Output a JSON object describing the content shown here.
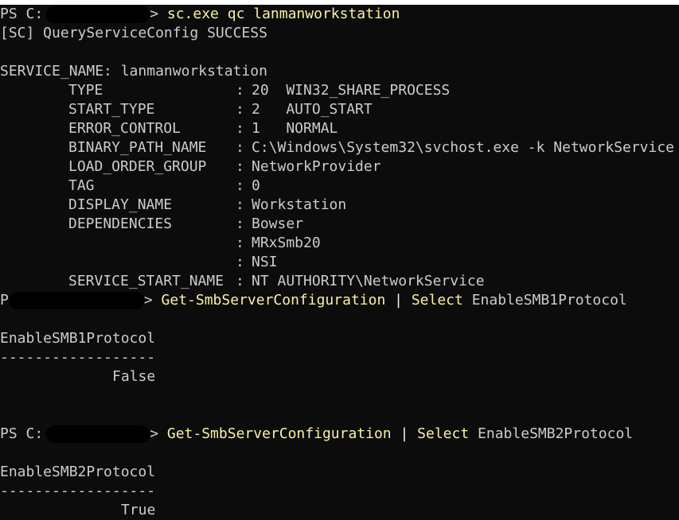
{
  "colors": {
    "background": "#0c0c0c",
    "foreground": "#cccccc",
    "command": "#f9f1a5",
    "operator": "#f2f2f2"
  },
  "prompt1": {
    "prefix": "PS C:",
    "suffix": ">",
    "command": "sc.exe qc lanmanworkstation"
  },
  "sc_output": {
    "result": "[SC] QueryServiceConfig SUCCESS",
    "service_name": "SERVICE_NAME: lanmanworkstation",
    "fields": [
      {
        "key": "TYPE",
        "value": "20  WIN32_SHARE_PROCESS"
      },
      {
        "key": "START_TYPE",
        "value": "2   AUTO_START"
      },
      {
        "key": "ERROR_CONTROL",
        "value": "1   NORMAL"
      },
      {
        "key": "BINARY_PATH_NAME",
        "value": "C:\\Windows\\System32\\svchost.exe -k NetworkService"
      },
      {
        "key": "LOAD_ORDER_GROUP",
        "value": "NetworkProvider"
      },
      {
        "key": "TAG",
        "value": "0"
      },
      {
        "key": "DISPLAY_NAME",
        "value": "Workstation"
      },
      {
        "key": "DEPENDENCIES",
        "value": "Bowser"
      },
      {
        "key": "",
        "value": "MRxSmb20"
      },
      {
        "key": "",
        "value": "NSI"
      },
      {
        "key": "SERVICE_START_NAME",
        "value": "NT AUTHORITY\\NetworkService"
      }
    ]
  },
  "prompt2": {
    "prefix": "P",
    "suffix": ">",
    "cmdlet": "Get-SmbServerConfiguration",
    "pipe": "|",
    "select": "Select",
    "property": "EnableSMB1Protocol"
  },
  "smb1": {
    "header": "EnableSMB1Protocol",
    "underline": "------------------",
    "value": "False"
  },
  "prompt3": {
    "prefix": "PS C:",
    "suffix": ">",
    "cmdlet": "Get-SmbServerConfiguration",
    "pipe": "|",
    "select": "Select",
    "property": "EnableSMB2Protocol"
  },
  "smb2": {
    "header": "EnableSMB2Protocol",
    "underline": "------------------",
    "value": "True"
  }
}
